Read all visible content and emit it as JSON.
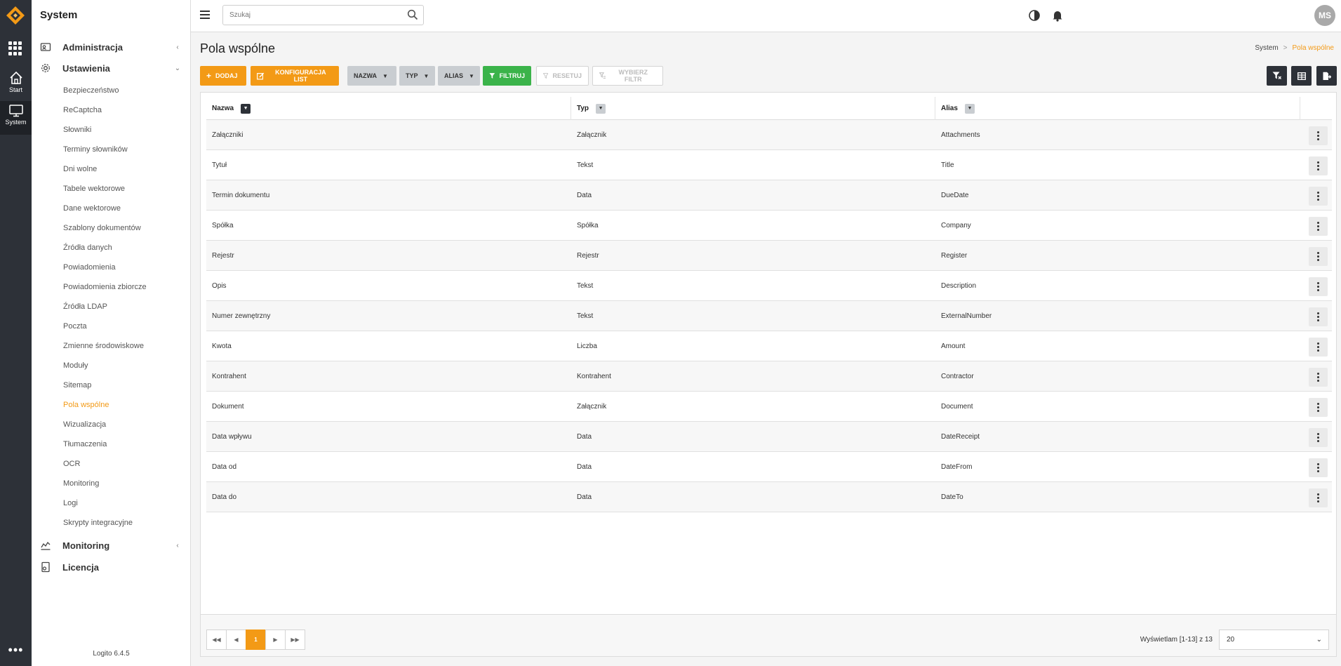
{
  "rail": {
    "items": [
      {
        "label": "Start",
        "icon": "home-icon"
      },
      {
        "label": "System",
        "icon": "monitor-icon"
      }
    ]
  },
  "sidebar": {
    "title": "System",
    "groups": {
      "administracja": "Administracja",
      "ustawienia": "Ustawienia",
      "monitoring": "Monitoring",
      "licencja": "Licencja"
    },
    "items": [
      "Bezpieczeństwo",
      "ReCaptcha",
      "Słowniki",
      "Terminy słowników",
      "Dni wolne",
      "Tabele wektorowe",
      "Dane wektorowe",
      "Szablony dokumentów",
      "Źródła danych",
      "Powiadomienia",
      "Powiadomienia zbiorcze",
      "Źródła LDAP",
      "Poczta",
      "Zmienne środowiskowe",
      "Moduły",
      "Sitemap",
      "Pola wspólne",
      "Wizualizacja",
      "Tłumaczenia",
      "OCR",
      "Monitoring",
      "Logi",
      "Skrypty integracyjne"
    ],
    "active_item": "Pola wspólne",
    "version": "Logito 6.4.5"
  },
  "topbar": {
    "search_placeholder": "Szukaj",
    "avatar_initials": "MS"
  },
  "page": {
    "title": "Pola wspólne",
    "breadcrumb": {
      "root": "System",
      "separator": ">",
      "current": "Pola wspólne"
    }
  },
  "toolbar": {
    "add": "DODAJ",
    "config": "KONFIGURACJA LIST",
    "col_nazwa": "NAZWA",
    "col_typ": "TYP",
    "col_alias": "ALIAS",
    "filter": "FILTRUJ",
    "reset": "RESETUJ",
    "choose_filter": "WYBIERZ FILTR"
  },
  "table": {
    "headers": {
      "nazwa": "Nazwa",
      "typ": "Typ",
      "alias": "Alias"
    },
    "rows": [
      {
        "nazwa": "Załączniki",
        "typ": "Załącznik",
        "alias": "Attachments"
      },
      {
        "nazwa": "Tytuł",
        "typ": "Tekst",
        "alias": "Title"
      },
      {
        "nazwa": "Termin dokumentu",
        "typ": "Data",
        "alias": "DueDate"
      },
      {
        "nazwa": "Spółka",
        "typ": "Spółka",
        "alias": "Company"
      },
      {
        "nazwa": "Rejestr",
        "typ": "Rejestr",
        "alias": "Register"
      },
      {
        "nazwa": "Opis",
        "typ": "Tekst",
        "alias": "Description"
      },
      {
        "nazwa": "Numer zewnętrzny",
        "typ": "Tekst",
        "alias": "ExternalNumber"
      },
      {
        "nazwa": "Kwota",
        "typ": "Liczba",
        "alias": "Amount"
      },
      {
        "nazwa": "Kontrahent",
        "typ": "Kontrahent",
        "alias": "Contractor"
      },
      {
        "nazwa": "Dokument",
        "typ": "Załącznik",
        "alias": "Document"
      },
      {
        "nazwa": "Data wpływu",
        "typ": "Data",
        "alias": "DateReceipt"
      },
      {
        "nazwa": "Data od",
        "typ": "Data",
        "alias": "DateFrom"
      },
      {
        "nazwa": "Data do",
        "typ": "Data",
        "alias": "DateTo"
      }
    ]
  },
  "footer": {
    "current_page": "1",
    "showing": "Wyświetlam [1-13] z 13",
    "page_size": "20"
  },
  "colors": {
    "accent": "#f39a16",
    "filter_green": "#3bb34a",
    "rail_dark": "#2d3138"
  }
}
